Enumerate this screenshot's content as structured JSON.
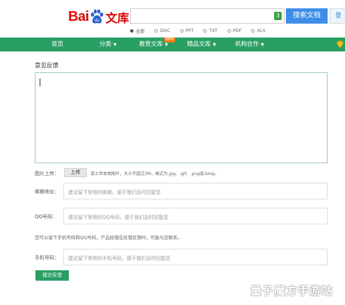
{
  "header": {
    "logo_text": "Bai",
    "logo_du": "du",
    "logo_wenku": "文库",
    "search": {
      "value": "",
      "placeholder": "",
      "count": "3"
    },
    "search_button": "搜索文档",
    "user_button": "登",
    "filters": [
      {
        "label": "全部",
        "selected": true
      },
      {
        "label": "DOC",
        "selected": false
      },
      {
        "label": "PPT",
        "selected": false
      },
      {
        "label": "TXT",
        "selected": false
      },
      {
        "label": "PDF",
        "selected": false
      },
      {
        "label": "XLS",
        "selected": false
      }
    ]
  },
  "nav": {
    "items": [
      {
        "label": "首页",
        "has_caret": false
      },
      {
        "label": "分类",
        "has_caret": true
      },
      {
        "label": "教育文库",
        "has_caret": true
      },
      {
        "label": "精品文库",
        "has_caret": true
      },
      {
        "label": "机构合作",
        "has_caret": true
      }
    ],
    "new_tag": "NEW",
    "caret": "▼"
  },
  "form": {
    "title": "意见反馈",
    "feedback": {
      "value": "",
      "placeholder": ""
    },
    "image_label": "图片上传：",
    "upload_button": "上传",
    "upload_hint": "请上传本地图片，大小不超过3M，格式为.jpg、.gif、.png或.bmp。",
    "email_label": "邮箱地址：",
    "email_placeholder": "建议留下常用的邮箱，便于我们及时回复您",
    "qq_label": "QQ号码：",
    "qq_placeholder": "建议留下常用的QQ号码，便于我们及时回复您",
    "note": "您可以留下手机号码和QQ号码，产品经理在处理反馈时，可能与您联系。",
    "phone_label": "手机号码：",
    "phone_placeholder": "建议留下常用的手机号码，便于我们及时回复您",
    "submit_button": "提交反馈"
  },
  "watermark": "量子魔方手游站",
  "colors": {
    "brand_green": "#2a9f63",
    "search_blue": "#3c8ee8",
    "logo_red": "#e10602"
  }
}
